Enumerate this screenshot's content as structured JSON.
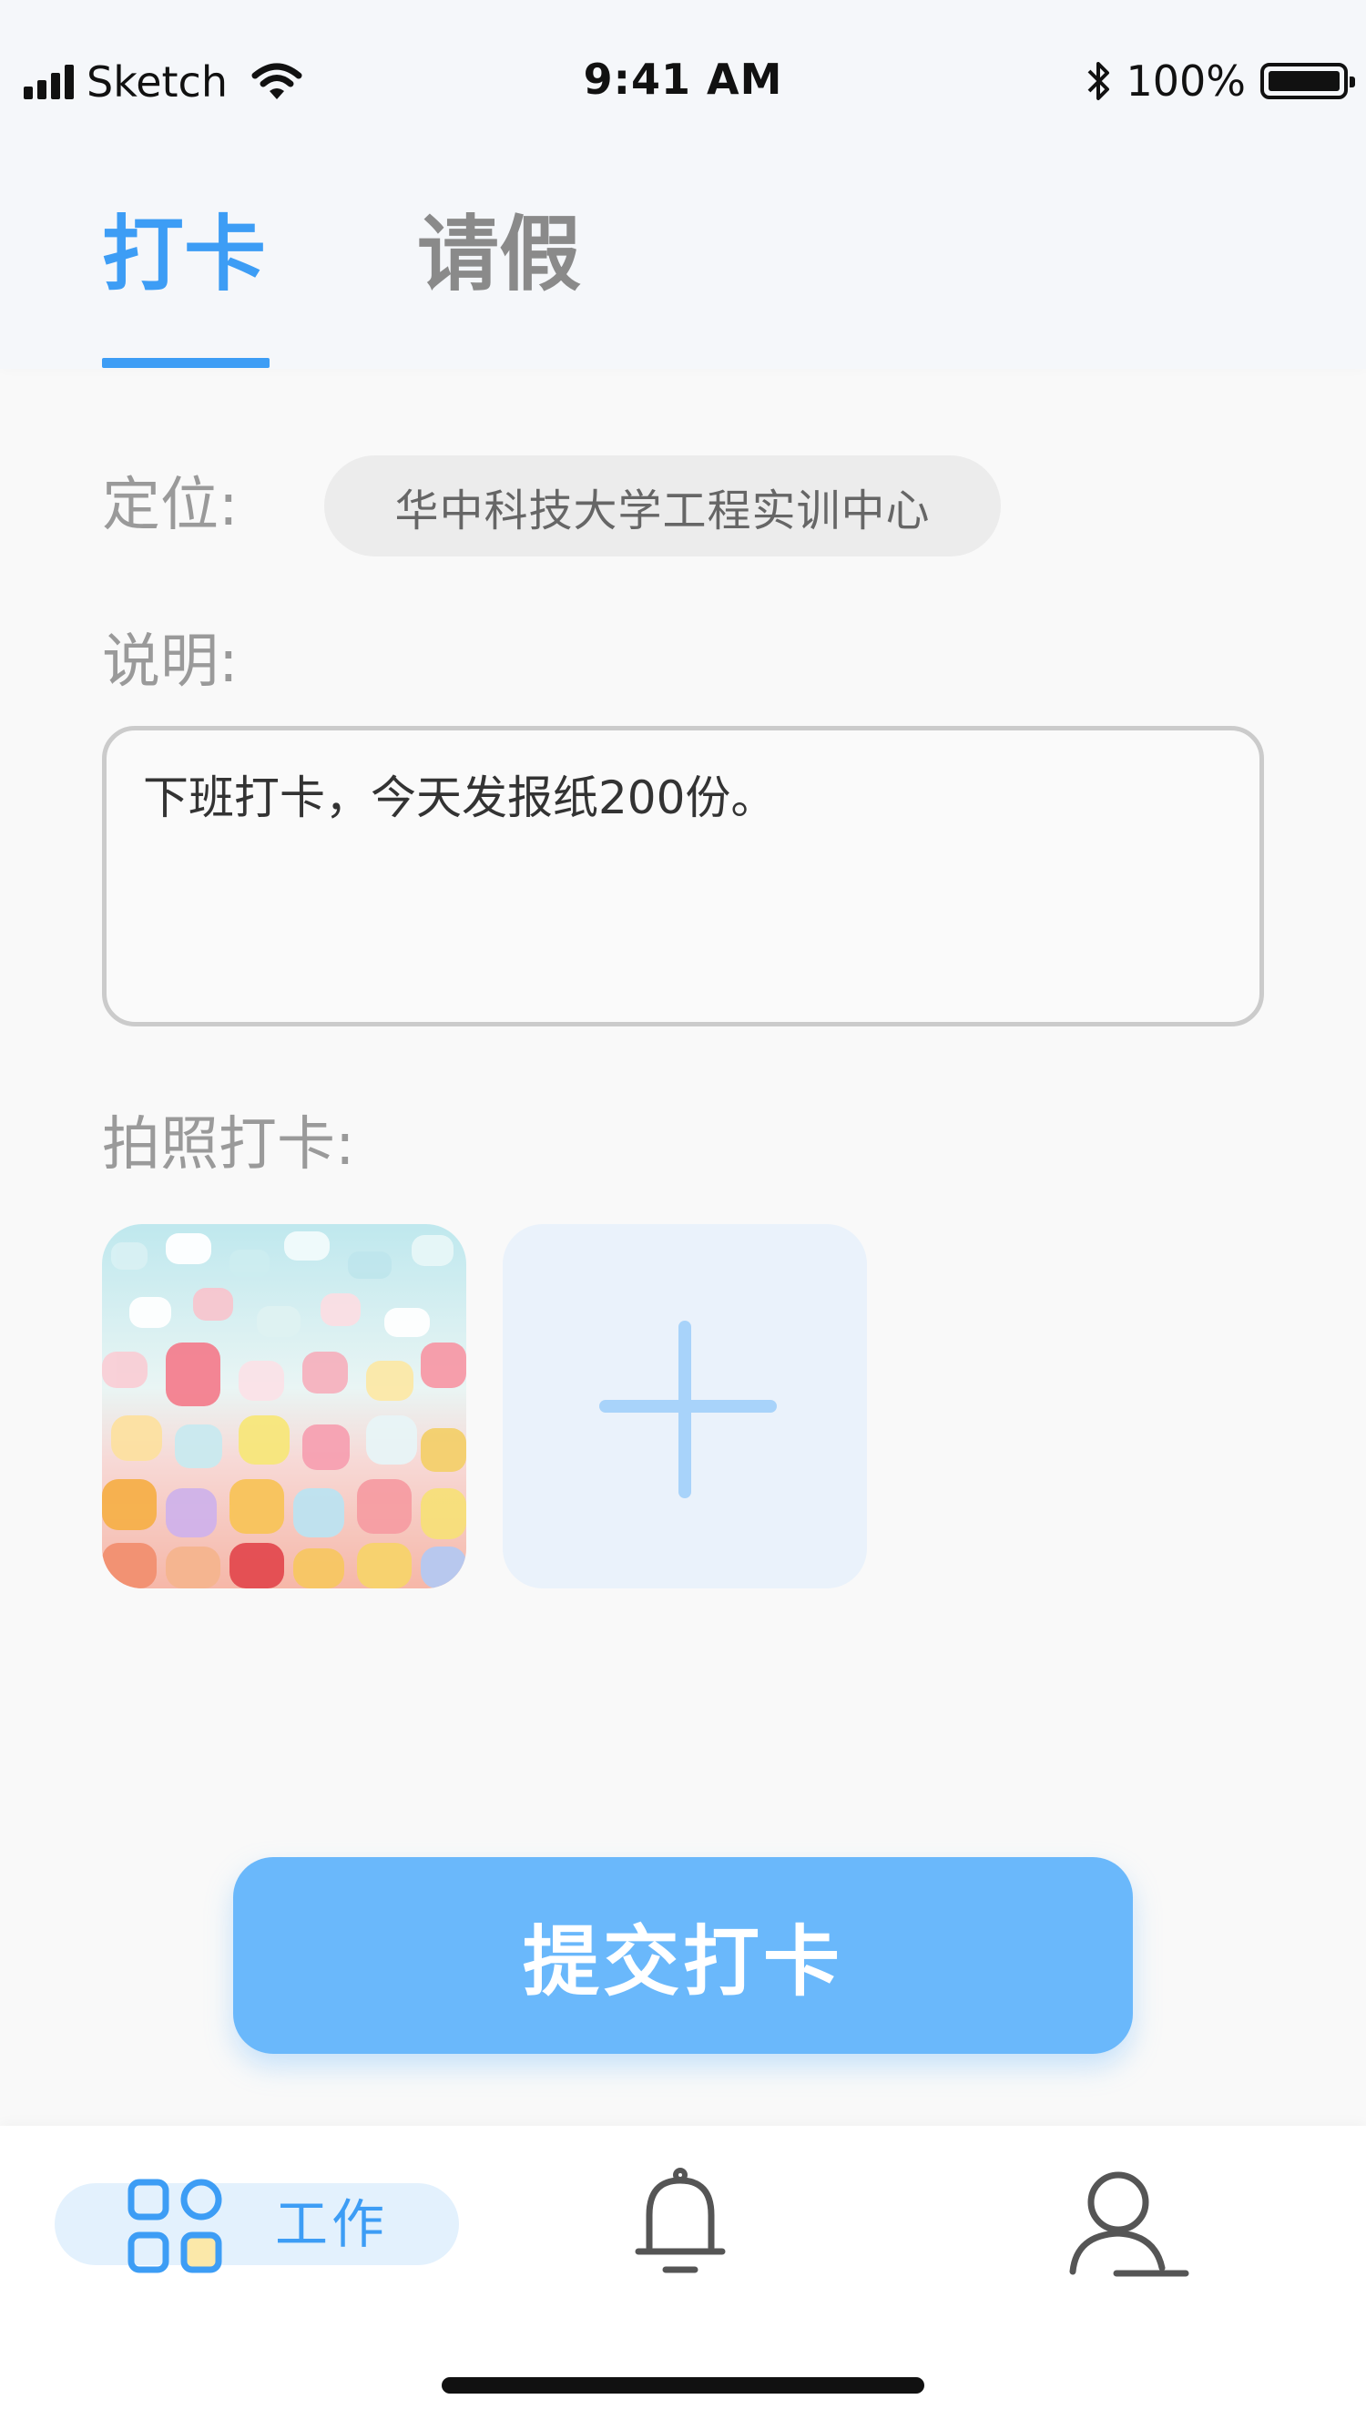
{
  "status_bar": {
    "carrier": "Sketch",
    "time": "9:41 AM",
    "battery": "100%"
  },
  "tabs": [
    {
      "label": "打卡",
      "active": true
    },
    {
      "label": "请假",
      "active": false
    }
  ],
  "form": {
    "location_label": "定位:",
    "location_value": "华中科技大学工程实训中心",
    "note_label": "说明:",
    "note_value": "下班打卡，今天发报纸200份。",
    "photo_label": "拍照打卡:"
  },
  "submit_label": "提交打卡",
  "tab_bar": {
    "work_label": "工作",
    "items": [
      "grid-icon",
      "bell-icon",
      "user-icon"
    ]
  },
  "colors": {
    "accent": "#3d9df5",
    "submit_bg": "#6ab8fb",
    "pill_bg": "#ececec",
    "add_photo_bg": "#eaf2fb"
  }
}
